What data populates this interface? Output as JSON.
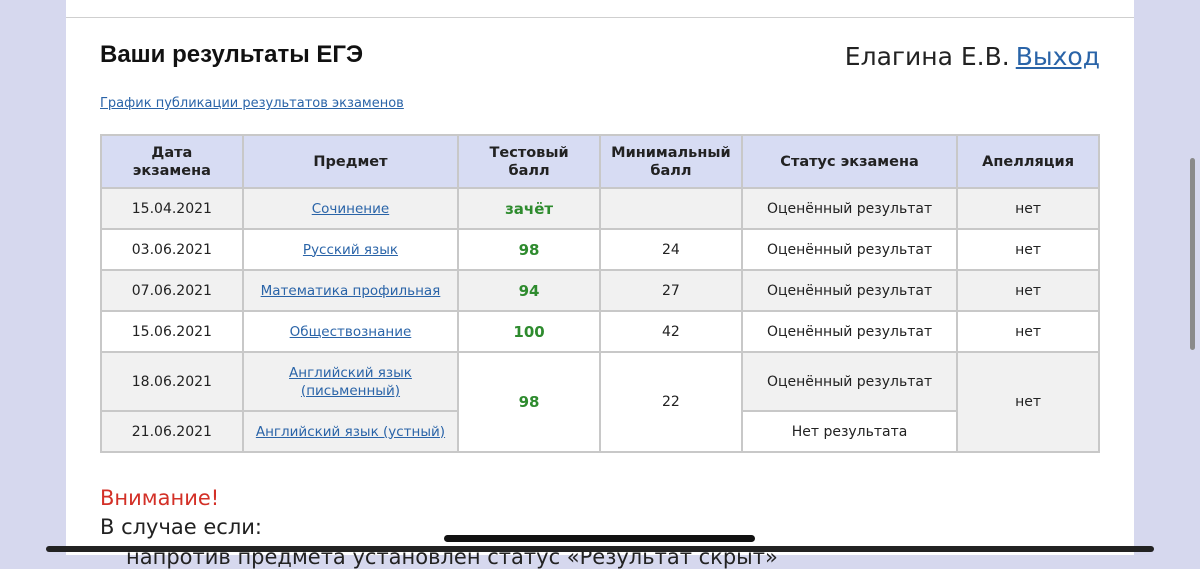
{
  "header": {
    "title": "Ваши результаты ЕГЭ",
    "user_name": "Елагина Е.В.",
    "logout_label": "Выход",
    "schedule_link": "График публикации результатов экзаменов"
  },
  "table": {
    "columns": [
      "Дата экзамена",
      "Предмет",
      "Тестовый балл",
      "Минимальный балл",
      "Статус экзамена",
      "Апелляция"
    ],
    "rows": [
      {
        "date": "15.04.2021",
        "subject": "Сочинение",
        "score": "зачёт",
        "min": "",
        "status": "Оценённый результат",
        "appeal": "нет"
      },
      {
        "date": "03.06.2021",
        "subject": "Русский язык",
        "score": "98",
        "min": "24",
        "status": "Оценённый результат",
        "appeal": "нет"
      },
      {
        "date": "07.06.2021",
        "subject": "Математика профильная",
        "score": "94",
        "min": "27",
        "status": "Оценённый результат",
        "appeal": "нет"
      },
      {
        "date": "15.06.2021",
        "subject": "Обществознание",
        "score": "100",
        "min": "42",
        "status": "Оценённый результат",
        "appeal": "нет"
      },
      {
        "date": "18.06.2021",
        "subject": "Английский язык (письменный)",
        "score": "98",
        "min": "22",
        "status": "Оценённый результат",
        "appeal": "нет"
      },
      {
        "date": "21.06.2021",
        "subject": "Английский язык (устный)",
        "status": "Нет результата"
      }
    ]
  },
  "notice": {
    "heading": "Внимание!",
    "intro": "В случае если:",
    "bullet_partial": "напротив предмета установлен статус «Результат скрыт»"
  },
  "colors": {
    "link": "#2a64a8",
    "score": "#2e8b2e",
    "warning": "#d33027",
    "header_bg": "#d7dcf3"
  }
}
